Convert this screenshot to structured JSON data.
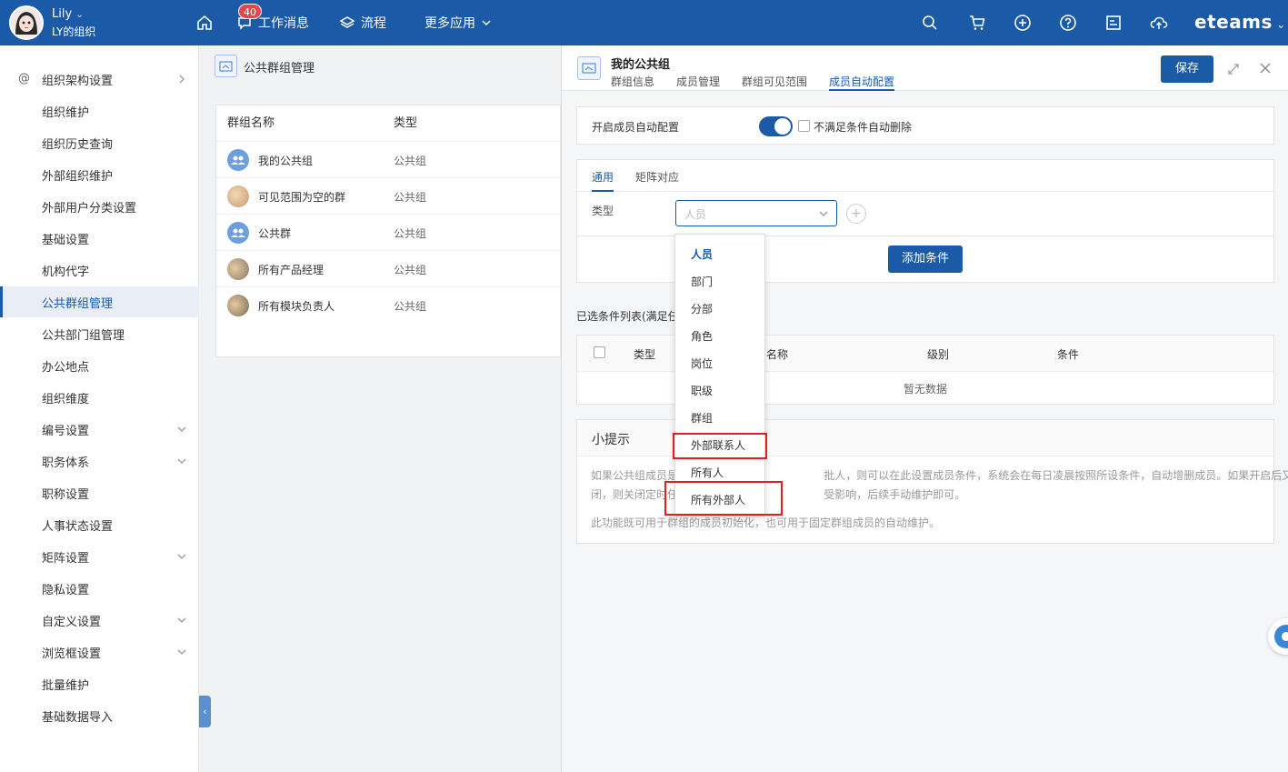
{
  "topbar": {
    "user_name": "Lily",
    "user_org": "LY的组织",
    "badge_count": "40",
    "nav": [
      "工作消息",
      "流程",
      "更多应用"
    ],
    "brand": "eteams"
  },
  "sidebar": {
    "items": [
      {
        "label": "组织架构设置"
      },
      {
        "label": "组织维护"
      },
      {
        "label": "组织历史查询"
      },
      {
        "label": "外部组织维护"
      },
      {
        "label": "外部用户分类设置"
      },
      {
        "label": "基础设置"
      },
      {
        "label": "机构代字"
      },
      {
        "label": "公共群组管理"
      },
      {
        "label": "公共部门组管理"
      },
      {
        "label": "办公地点"
      },
      {
        "label": "组织维度"
      },
      {
        "label": "编号设置"
      },
      {
        "label": "职务体系"
      },
      {
        "label": "职称设置"
      },
      {
        "label": "人事状态设置"
      },
      {
        "label": "矩阵设置"
      },
      {
        "label": "隐私设置"
      },
      {
        "label": "自定义设置"
      },
      {
        "label": "浏览框设置"
      },
      {
        "label": "批量维护"
      },
      {
        "label": "基础数据导入"
      }
    ]
  },
  "middle": {
    "title": "公共群组管理",
    "col_name": "群组名称",
    "col_type": "类型",
    "rows": [
      {
        "name": "我的公共组",
        "type": "公共组"
      },
      {
        "name": "可见范围为空的群",
        "type": "公共组"
      },
      {
        "name": "公共群",
        "type": "公共组"
      },
      {
        "name": "所有产品经理",
        "type": "公共组"
      },
      {
        "name": "所有模块负责人",
        "type": "公共组"
      }
    ]
  },
  "drawer": {
    "title": "我的公共组",
    "tabs": [
      "群组信息",
      "成员管理",
      "群组可见范围",
      "成员自动配置"
    ],
    "save_label": "保存",
    "auto_config_label": "开启成员自动配置",
    "auto_config_on": true,
    "auto_delete_label": "不满足条件自动删除",
    "subtabs": [
      "通用",
      "矩阵对应"
    ],
    "type_label": "类型",
    "type_placeholder": "人员",
    "add_condition_label": "添加条件",
    "selected_list_title": "已选条件列表(满足任",
    "table_cols": [
      "类型",
      "名称",
      "级别",
      "条件"
    ],
    "empty_text": "暂无数据",
    "tips_title": "小提示",
    "tip_line1": "如果公共组成员是                                          批人，则可以在此设置成员条件，系统会在每日凌晨按照所设条件，自动增删成员。如果开启后又关",
    "tip_line2": "闭，则关闭定时任                                          受影响，后续手动维护即可。",
    "tip_line3": "此功能既可用于群组的成员初始化，也可用于固定群组成员的自动维护。"
  },
  "dropdown": {
    "options": [
      "人员",
      "部门",
      "分部",
      "角色",
      "岗位",
      "职级",
      "群组",
      "外部联系人",
      "所有人",
      "所有外部人"
    ],
    "selected": "人员"
  },
  "colors": {
    "primary": "#1a5aa7",
    "highlight_box": "#e02020"
  }
}
